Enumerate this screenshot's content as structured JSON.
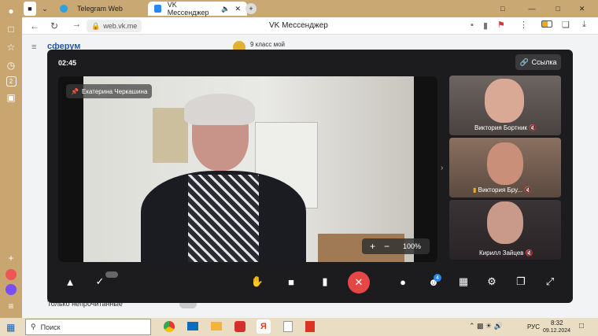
{
  "browser": {
    "tabs": [
      {
        "label": "Telegram Web"
      },
      {
        "label": "VK Мессенджер"
      }
    ],
    "address": "web.vk.me",
    "page_title": "VK Мессенджер"
  },
  "vk": {
    "brand": "сферум",
    "chat_title": "9 класс мой",
    "filter_label": "Только непрочитанные"
  },
  "call": {
    "timer": "02:45",
    "link_button": "Ссылка",
    "pinned_name": "Екатерина Черкашина",
    "zoom": "100%",
    "participants": [
      {
        "name": "Виктория Бортник"
      },
      {
        "name": "Виктория Бру..."
      },
      {
        "name": "Кирилл Зайцев"
      }
    ],
    "badge_count": "4"
  },
  "taskbar": {
    "search_placeholder": "Поиск",
    "lang": "РУС",
    "time": "8:32",
    "date": "09.12.2024"
  },
  "sidebar_badge": "2"
}
